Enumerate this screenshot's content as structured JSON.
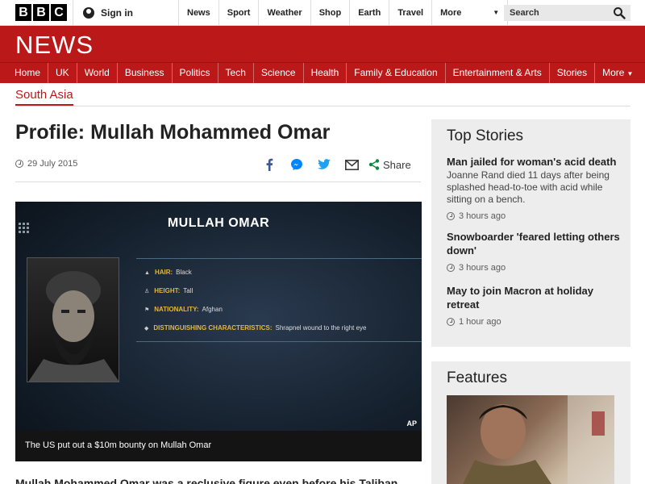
{
  "global_bar": {
    "logo_letters": [
      "B",
      "B",
      "C"
    ],
    "sign_in": "Sign in",
    "nav": [
      "News",
      "Sport",
      "Weather",
      "Shop",
      "Earth",
      "Travel"
    ],
    "more": "More",
    "search_placeholder": "Search"
  },
  "masthead": {
    "title": "NEWS",
    "nav": [
      "Home",
      "UK",
      "World",
      "Business",
      "Politics",
      "Tech",
      "Science",
      "Health",
      "Family & Education",
      "Entertainment & Arts",
      "Stories"
    ],
    "more": "More"
  },
  "article": {
    "section": "South Asia",
    "headline": "Profile: Mullah Mohammed Omar",
    "date": "29 July 2015",
    "share_label": "Share",
    "media": {
      "title": "MULLAH OMAR",
      "facts": [
        {
          "key": "HAIR:",
          "value": "Black"
        },
        {
          "key": "HEIGHT:",
          "value": "Tall"
        },
        {
          "key": "NATIONALITY:",
          "value": "Afghan"
        },
        {
          "key": "DISTINGUISHING CHARACTERISTICS:",
          "value": "Shrapnel wound to the right eye"
        }
      ],
      "credit": "AP",
      "caption": "The US put out a $10m bounty on Mullah Omar"
    },
    "lead": "Mullah Mohammed Omar was a reclusive figure even before his Taliban"
  },
  "sidebar": {
    "top_stories": {
      "heading": "Top Stories",
      "items": [
        {
          "title": "Man jailed for woman's acid death",
          "summary": "Joanne Rand died 11 days after being splashed head-to-toe with acid while sitting on a bench.",
          "time": "3 hours ago"
        },
        {
          "title": "Snowboarder 'feared letting others down'",
          "summary": "",
          "time": "3 hours ago"
        },
        {
          "title": "May to join Macron at holiday retreat",
          "summary": "",
          "time": "1 hour ago"
        }
      ]
    },
    "features": {
      "heading": "Features"
    }
  },
  "colors": {
    "brand_red": "#bb1919",
    "facebook": "#3b5998",
    "messenger": "#0084ff",
    "twitter": "#1da1f2",
    "share_green": "#0a8a3a"
  }
}
